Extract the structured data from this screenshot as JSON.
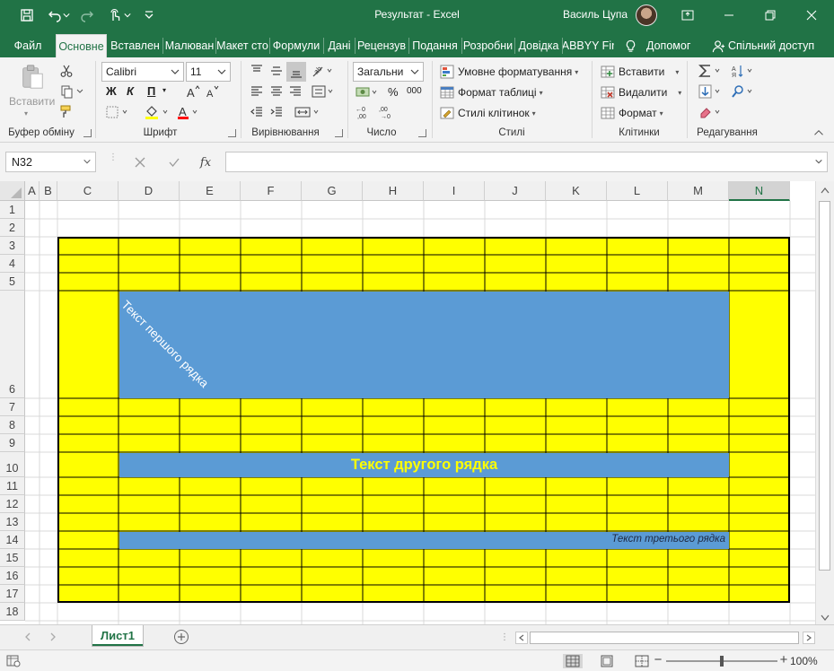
{
  "window": {
    "title": "Результат  -  Excel",
    "user": "Василь Цупа"
  },
  "tabs": [
    {
      "label": "Файл",
      "active": false
    },
    {
      "label": "Основне",
      "active": true
    },
    {
      "label": "Вставлен",
      "active": false
    },
    {
      "label": "Малюван",
      "active": false
    },
    {
      "label": "Макет сто",
      "active": false
    },
    {
      "label": "Формули",
      "active": false
    },
    {
      "label": "Дані",
      "active": false
    },
    {
      "label": "Рецензув",
      "active": false
    },
    {
      "label": "Подання",
      "active": false
    },
    {
      "label": "Розробни",
      "active": false
    },
    {
      "label": "Довідка",
      "active": false
    },
    {
      "label": "ABBYY Fir",
      "active": false
    }
  ],
  "tell_me": "Допомог",
  "share": "Спільний доступ",
  "ribbon": {
    "clipboard": {
      "label": "Буфер обміну",
      "paste": "Вставити"
    },
    "font": {
      "label": "Шрифт",
      "name": "Calibri",
      "size": "11",
      "bold": "Ж",
      "italic": "К",
      "underline": "П"
    },
    "alignment": {
      "label": "Вирівнювання"
    },
    "number": {
      "label": "Число",
      "format": "Загальни",
      "percent": "%",
      "thousands": "000"
    },
    "styles": {
      "label": "Стилі",
      "conditional": "Умовне форматування",
      "table": "Формат таблиці",
      "cell_styles": "Стилі клітинок"
    },
    "cells": {
      "label": "Клітинки",
      "insert": "Вставити",
      "delete": "Видалити",
      "format": "Формат"
    },
    "editing": {
      "label": "Редагування"
    }
  },
  "formula_bar": {
    "name_box": "N32",
    "fx": "fx",
    "value": ""
  },
  "columns": [
    "A",
    "B",
    "C",
    "D",
    "E",
    "F",
    "G",
    "H",
    "I",
    "J",
    "K",
    "L",
    "M",
    "N"
  ],
  "selected_column": "N",
  "rows": [
    "1",
    "2",
    "3",
    "4",
    "5",
    "6",
    "7",
    "8",
    "9",
    "10",
    "11",
    "12",
    "13",
    "14",
    "15",
    "16",
    "17",
    "18"
  ],
  "cells": {
    "row6_text": "Текст першого рядка",
    "row10_text": "Текст другого рядка",
    "row14_text": "Текст третього рядка",
    "fill_color": "#ffff00",
    "merged_color": "#5b9bd5",
    "row10_text_color": "#ffff00"
  },
  "sheet_tab": "Лист1",
  "status": {
    "zoom": "100%",
    "zoom_value": 100
  }
}
